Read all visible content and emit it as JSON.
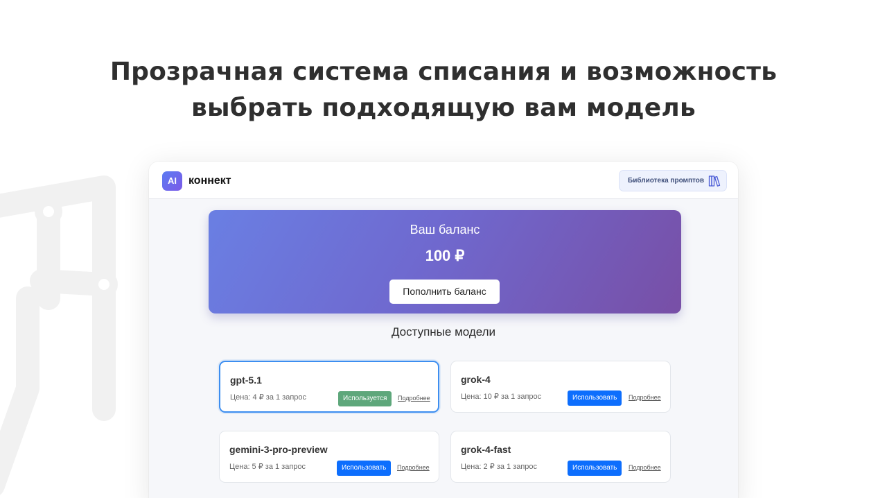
{
  "headline": {
    "line1": "Прозрачная система списания и возможность",
    "line2": "выбрать подходящую вам модель"
  },
  "app": {
    "logo_badge": "AI",
    "logo_text": "коннект",
    "library_button": "Библиотека промптов",
    "library_icon": "books-icon"
  },
  "balance": {
    "title": "Ваш баланс",
    "amount": "100 ₽",
    "topup_button": "Пополнить баланс"
  },
  "models": {
    "title": "Доступные модели",
    "details_label": "Подробнее",
    "items": [
      {
        "name": "gpt-5.1",
        "price": "Цена: 4 ₽ за 1 запрос",
        "button": "Используется"
      },
      {
        "name": "grok-4",
        "price": "Цена: 10 ₽ за 1 запрос",
        "button": "Использовать"
      },
      {
        "name": "gemini-3-pro-preview",
        "price": "Цена: 5 ₽ за 1 запрос",
        "button": "Использовать"
      },
      {
        "name": "grok-4-fast",
        "price": "Цена: 2 ₽ за 1 запрос",
        "button": "Использовать"
      }
    ]
  },
  "colors": {
    "accent": "#0d6efd",
    "active_button": "#5ea77b",
    "balance_gradient_start": "#6a7fe3",
    "balance_gradient_end": "#784fa6"
  }
}
